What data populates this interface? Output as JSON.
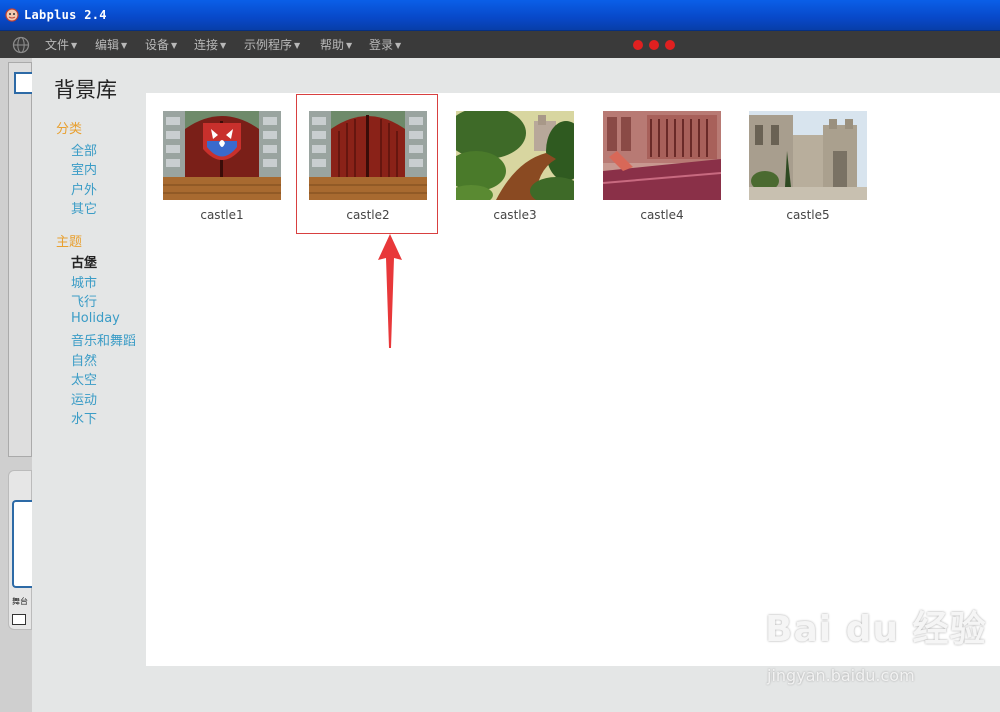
{
  "window": {
    "title": "Labplus 2.4"
  },
  "menu": {
    "items": [
      "文件",
      "编辑",
      "设备",
      "连接",
      "示例程序",
      "帮助",
      "登录"
    ],
    "status_color": "#e02020"
  },
  "dialog": {
    "title": "背景库",
    "category_section": "分类",
    "categories": [
      "全部",
      "室内",
      "户外",
      "其它"
    ],
    "theme_section": "主题",
    "themes": [
      "古堡",
      "城市",
      "飞行",
      "Holiday",
      "音乐和舞蹈",
      "自然",
      "太空",
      "运动",
      "水下"
    ],
    "active_theme": "古堡",
    "backdrops": [
      "castle1",
      "castle2",
      "castle3",
      "castle4",
      "castle5"
    ],
    "selected_backdrop": "castle2"
  },
  "underlying_app": {
    "stage_label": "舞台"
  },
  "watermark": {
    "brand": "Bai du 经验",
    "site": "jingyan.baidu.com"
  },
  "annotation_color": "#e8383a"
}
